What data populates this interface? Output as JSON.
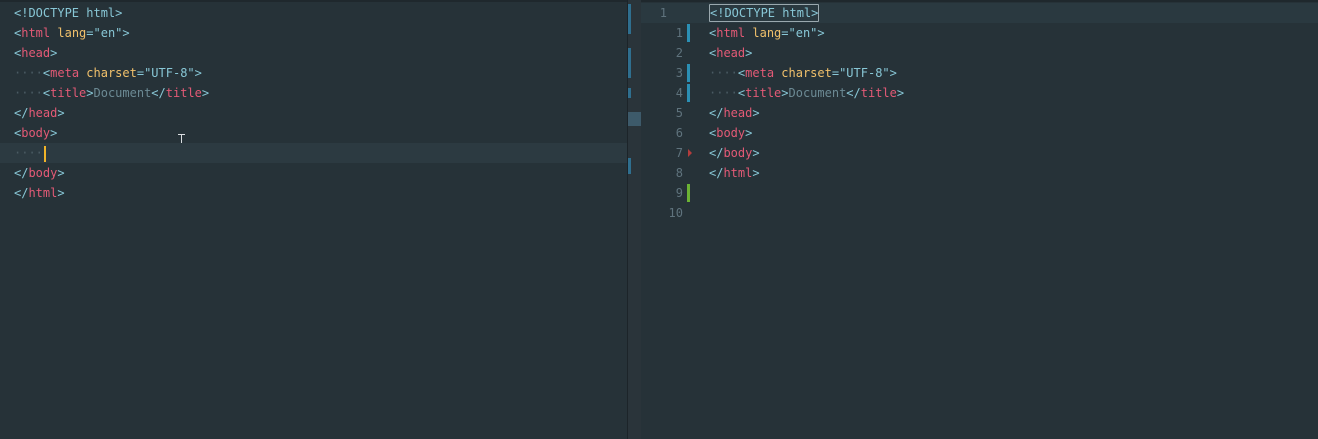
{
  "left_editor": {
    "lines": [
      [
        {
          "t": "<!DOCTYPE html>",
          "c": "doctype"
        }
      ],
      [
        {
          "t": "<",
          "c": "punct"
        },
        {
          "t": "html",
          "c": "tag"
        },
        {
          "t": " ",
          "c": ""
        },
        {
          "t": "lang",
          "c": "attr"
        },
        {
          "t": "=\"en\">",
          "c": "punct"
        }
      ],
      [
        {
          "t": "<",
          "c": "punct"
        },
        {
          "t": "head",
          "c": "tag"
        },
        {
          "t": ">",
          "c": "punct"
        }
      ],
      [
        {
          "t": "····",
          "c": "guide"
        },
        {
          "t": "<",
          "c": "punct"
        },
        {
          "t": "meta",
          "c": "tag"
        },
        {
          "t": " ",
          "c": ""
        },
        {
          "t": "charset",
          "c": "attr"
        },
        {
          "t": "=\"UTF-8\">",
          "c": "punct"
        }
      ],
      [
        {
          "t": "····",
          "c": "guide"
        },
        {
          "t": "<",
          "c": "punct"
        },
        {
          "t": "title",
          "c": "tag"
        },
        {
          "t": ">",
          "c": "punct"
        },
        {
          "t": "Document",
          "c": "txt"
        },
        {
          "t": "</",
          "c": "punct"
        },
        {
          "t": "title",
          "c": "tag"
        },
        {
          "t": ">",
          "c": "punct"
        }
      ],
      [
        {
          "t": "</",
          "c": "punct"
        },
        {
          "t": "head",
          "c": "tag"
        },
        {
          "t": ">",
          "c": "punct"
        }
      ],
      [
        {
          "t": "<",
          "c": "punct"
        },
        {
          "t": "body",
          "c": "tag"
        },
        {
          "t": ">",
          "c": "punct"
        }
      ],
      [
        {
          "t": "····",
          "c": "guide"
        }
      ],
      [
        {
          "t": "</",
          "c": "punct"
        },
        {
          "t": "body",
          "c": "tag"
        },
        {
          "t": ">",
          "c": "punct"
        }
      ],
      [
        {
          "t": "</",
          "c": "punct"
        },
        {
          "t": "html",
          "c": "tag"
        },
        {
          "t": ">",
          "c": "punct"
        }
      ]
    ],
    "cursor_line": 7
  },
  "right_editor": {
    "line_numbers": [
      "1",
      "1",
      "2",
      "3",
      "4",
      "5",
      "6",
      "7",
      "8",
      "9",
      "10"
    ],
    "lines": [
      [
        {
          "t": "<!DOCTYPE html>",
          "c": "doctype",
          "box": true
        }
      ],
      [
        {
          "t": "<",
          "c": "punct"
        },
        {
          "t": "html",
          "c": "tag"
        },
        {
          "t": " ",
          "c": ""
        },
        {
          "t": "lang",
          "c": "attr"
        },
        {
          "t": "=\"en\">",
          "c": "punct"
        }
      ],
      [
        {
          "t": "<",
          "c": "punct"
        },
        {
          "t": "head",
          "c": "tag"
        },
        {
          "t": ">",
          "c": "punct"
        }
      ],
      [
        {
          "t": "····",
          "c": "guide"
        },
        {
          "t": "<",
          "c": "punct"
        },
        {
          "t": "meta",
          "c": "tag"
        },
        {
          "t": " ",
          "c": ""
        },
        {
          "t": "charset",
          "c": "attr"
        },
        {
          "t": "=\"UTF-8\">",
          "c": "punct"
        }
      ],
      [
        {
          "t": "····",
          "c": "guide"
        },
        {
          "t": "<",
          "c": "punct"
        },
        {
          "t": "title",
          "c": "tag"
        },
        {
          "t": ">",
          "c": "punct"
        },
        {
          "t": "Document",
          "c": "txt"
        },
        {
          "t": "</",
          "c": "punct"
        },
        {
          "t": "title",
          "c": "tag"
        },
        {
          "t": ">",
          "c": "punct"
        }
      ],
      [
        {
          "t": "</",
          "c": "punct"
        },
        {
          "t": "head",
          "c": "tag"
        },
        {
          "t": ">",
          "c": "punct"
        }
      ],
      [
        {
          "t": "<",
          "c": "punct"
        },
        {
          "t": "body",
          "c": "tag"
        },
        {
          "t": ">",
          "c": "punct"
        }
      ],
      [
        {
          "t": "</",
          "c": "punct"
        },
        {
          "t": "body",
          "c": "tag"
        },
        {
          "t": ">",
          "c": "punct"
        }
      ],
      [
        {
          "t": "</",
          "c": "punct"
        },
        {
          "t": "html",
          "c": "tag"
        },
        {
          "t": ">",
          "c": "punct"
        }
      ],
      [],
      []
    ],
    "gutter_marks": [
      "none",
      "mod",
      "none",
      "mod",
      "mod",
      "none",
      "none",
      "arrow",
      "none",
      "add",
      "none"
    ]
  },
  "colors": {
    "background": "#263238",
    "tag": "#e35a76",
    "attribute": "#f0c06b",
    "punctuation": "#88c7d6",
    "caret": "#f0b429",
    "modified_marker": "#2b8fb4",
    "added_marker": "#6bb334"
  }
}
